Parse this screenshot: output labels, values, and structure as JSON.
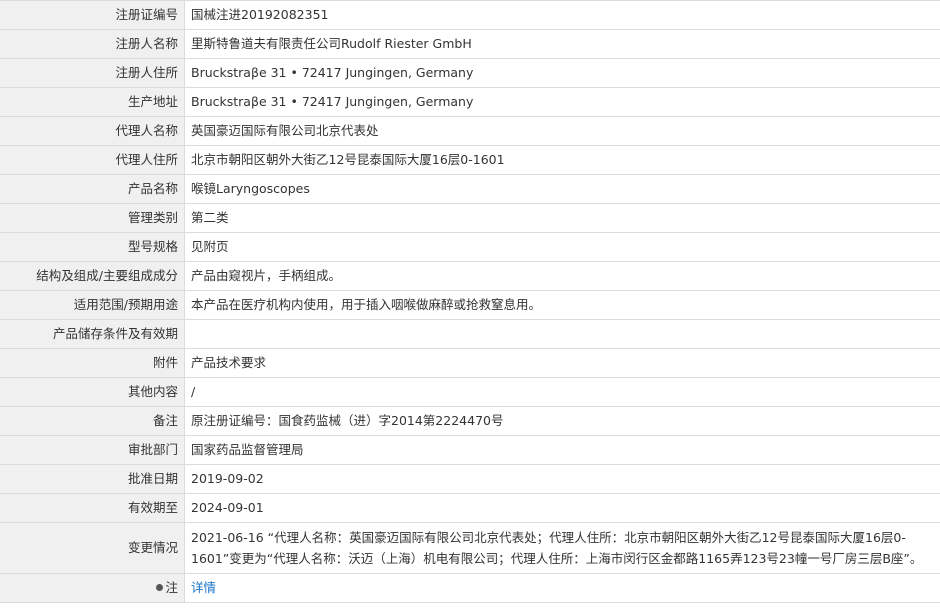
{
  "rows": [
    {
      "label": "注册证编号",
      "value": "国械注进20192082351"
    },
    {
      "label": "注册人名称",
      "value": "里斯特鲁道夫有限责任公司Rudolf Riester GmbH"
    },
    {
      "label": "注册人住所",
      "value": "Bruckstraβe 31 • 72417 Jungingen, Germany"
    },
    {
      "label": "生产地址",
      "value": "Bruckstraβe 31 • 72417 Jungingen, Germany"
    },
    {
      "label": "代理人名称",
      "value": "英国豪迈国际有限公司北京代表处"
    },
    {
      "label": "代理人住所",
      "value": "北京市朝阳区朝外大街乙12号昆泰国际大厦16层0-1601"
    },
    {
      "label": "产品名称",
      "value": "喉镜Laryngoscopes"
    },
    {
      "label": "管理类别",
      "value": "第二类"
    },
    {
      "label": "型号规格",
      "value": "见附页"
    },
    {
      "label": "结构及组成/主要组成成分",
      "value": "产品由窥视片，手柄组成。"
    },
    {
      "label": "适用范围/预期用途",
      "value": "本产品在医疗机构内使用，用于插入咽喉做麻醉或抢救窒息用。"
    },
    {
      "label": "产品储存条件及有效期",
      "value": ""
    },
    {
      "label": "附件",
      "value": "产品技术要求"
    },
    {
      "label": "其他内容",
      "value": "/"
    },
    {
      "label": "备注",
      "value": "原注册证编号：国食药监械（进）字2014第2224470号"
    },
    {
      "label": "审批部门",
      "value": "国家药品监督管理局"
    },
    {
      "label": "批准日期",
      "value": "2019-09-02"
    },
    {
      "label": "有效期至",
      "value": "2024-09-01"
    },
    {
      "label": "变更情况",
      "value": "2021-06-16 “代理人名称：英国豪迈国际有限公司北京代表处；代理人住所：北京市朝阳区朝外大街乙12号昆泰国际大厦16层0-1601”变更为“代理人名称：沃迈（上海）机电有限公司；代理人住所：上海市闵行区金都路1165弄123号23幢一号厂房三层B座”。"
    },
    {
      "label": "注",
      "value": "详情"
    }
  ],
  "icons": {
    "note": "bullet-dot-icon"
  },
  "colors": {
    "label_bg": "#f0f0f0",
    "border": "#dcdcdc",
    "link": "#1a73c8"
  }
}
